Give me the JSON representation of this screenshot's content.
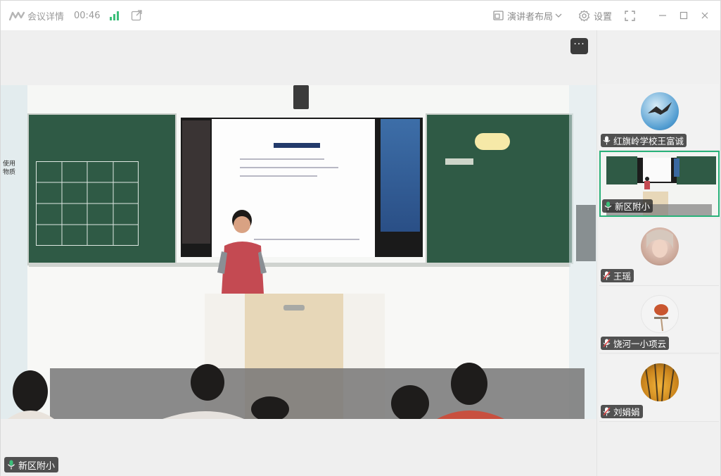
{
  "titlebar": {
    "meeting_details": "会议详情",
    "duration": "00:46",
    "layout_label": "演讲者布局",
    "settings_label": "设置"
  },
  "stage": {
    "more_label": "···",
    "speaker_name": "新区附小",
    "side_text_1": "使用",
    "side_text_2": "物质"
  },
  "participants": [
    {
      "name": "红旗岭学校王富诚",
      "mic": "on"
    },
    {
      "name": "新区附小",
      "mic": "on",
      "active": true
    },
    {
      "name": "王瑶",
      "mic": "muted"
    },
    {
      "name": "饶河一小项云",
      "mic": "muted"
    },
    {
      "name": "刘娟娟",
      "mic": "muted"
    }
  ],
  "colors": {
    "accent": "#29b27a",
    "signal": "#3cbf7a",
    "mic_on": "#ffffff",
    "mic_muted": "#e04848"
  }
}
